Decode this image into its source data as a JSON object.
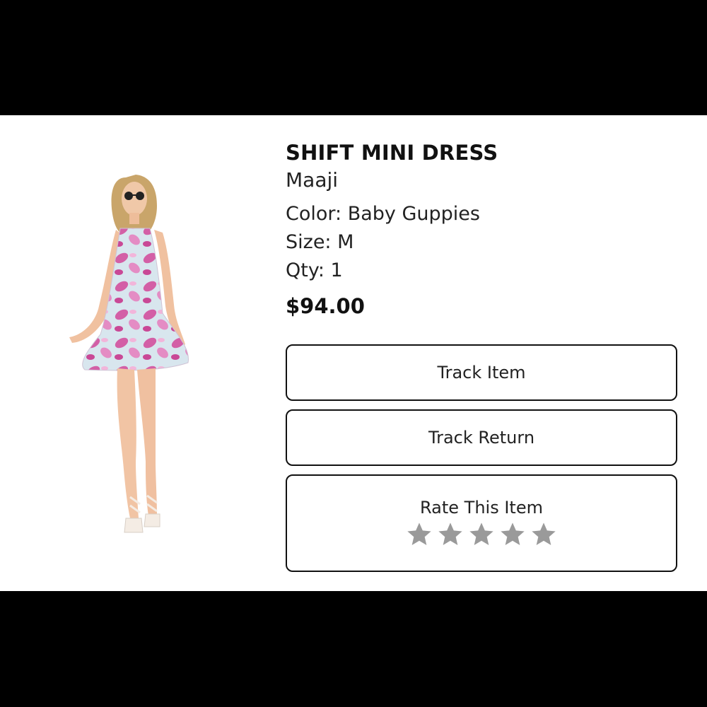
{
  "product": {
    "title": "SHIFT MINI DRESS",
    "brand": "Maaji",
    "color": "Color: Baby Guppies",
    "size": "Size: M",
    "qty": "Qty: 1",
    "price": "$94.00",
    "image_icon": "product-photo-dress"
  },
  "actions": {
    "track_item": "Track Item",
    "track_return": "Track Return",
    "rate_item": "Rate This Item"
  },
  "rating": {
    "max_stars": 5,
    "value": 0,
    "star_color": "#9a9a9a"
  },
  "colors": {
    "background": "#ffffff",
    "letterbox": "#000000",
    "text": "#111111",
    "border": "#111111"
  }
}
